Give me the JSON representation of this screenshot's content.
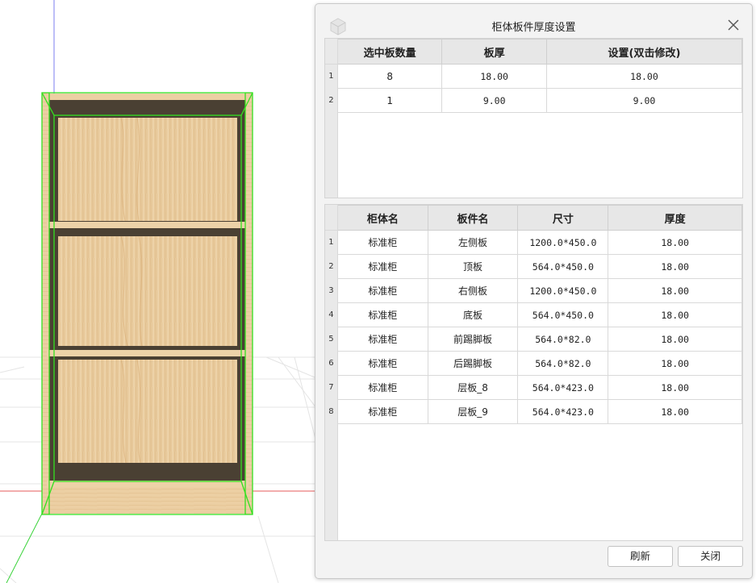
{
  "dialog": {
    "title": "柜体板件厚度设置",
    "thickness_table": {
      "headers": [
        "选中板数量",
        "板厚",
        "设置(双击修改)"
      ],
      "rows": [
        {
          "index": "1",
          "count": "8",
          "thickness": "18.00",
          "setting": "18.00"
        },
        {
          "index": "2",
          "count": "1",
          "thickness": "9.00",
          "setting": "9.00"
        }
      ]
    },
    "panel_table": {
      "headers": [
        "柜体名",
        "板件名",
        "尺寸",
        "厚度"
      ],
      "rows": [
        {
          "index": "1",
          "cabinet": "标准柜",
          "panel": "左侧板",
          "size": "1200.0*450.0",
          "thickness": "18.00"
        },
        {
          "index": "2",
          "cabinet": "标准柜",
          "panel": "顶板",
          "size": "564.0*450.0",
          "thickness": "18.00"
        },
        {
          "index": "3",
          "cabinet": "标准柜",
          "panel": "右侧板",
          "size": "1200.0*450.0",
          "thickness": "18.00"
        },
        {
          "index": "4",
          "cabinet": "标准柜",
          "panel": "底板",
          "size": "564.0*450.0",
          "thickness": "18.00"
        },
        {
          "index": "5",
          "cabinet": "标准柜",
          "panel": "前踢脚板",
          "size": "564.0*82.0",
          "thickness": "18.00"
        },
        {
          "index": "6",
          "cabinet": "标准柜",
          "panel": "后踢脚板",
          "size": "564.0*82.0",
          "thickness": "18.00"
        },
        {
          "index": "7",
          "cabinet": "标准柜",
          "panel": "层板_8",
          "size": "564.0*423.0",
          "thickness": "18.00"
        },
        {
          "index": "8",
          "cabinet": "标准柜",
          "panel": "层板_9",
          "size": "564.0*423.0",
          "thickness": "18.00"
        }
      ]
    },
    "buttons": {
      "refresh": "刷新",
      "close": "关闭"
    }
  },
  "icons": {
    "logo": "cube-logo-icon",
    "close": "close-icon"
  },
  "colors": {
    "selection_outline": "#33e01f",
    "wood": "#e7c797",
    "dark_panel": "#4a4033",
    "axis_blue": "#7b7cf0",
    "axis_red": "#e45b5b",
    "axis_green": "#3ad33a"
  }
}
